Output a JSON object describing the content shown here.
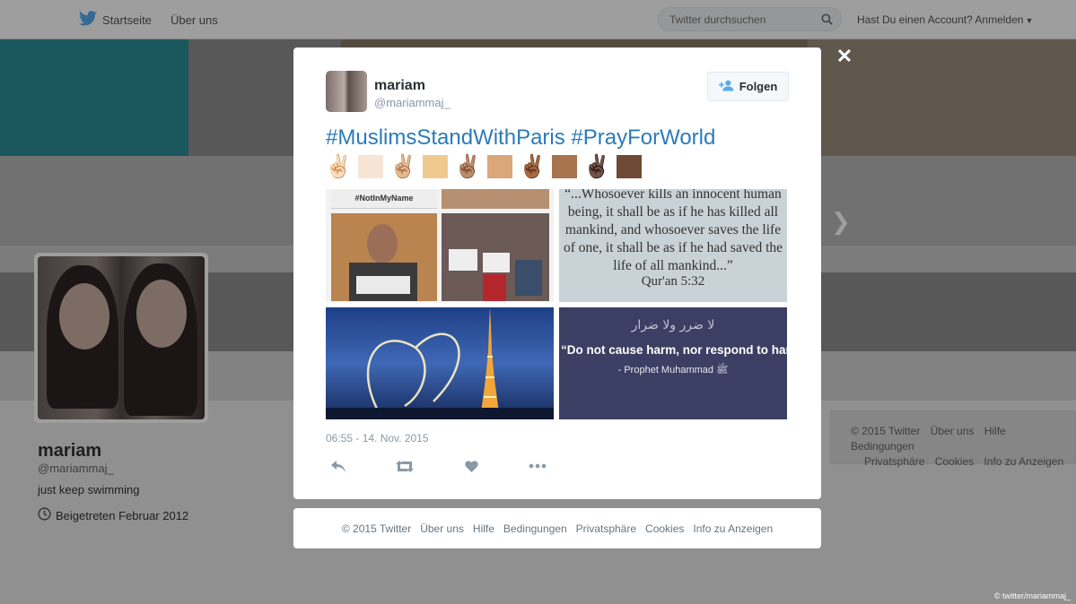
{
  "topbar": {
    "home_label": "Startseite",
    "about_label": "Über uns",
    "search_placeholder": "Twitter durchsuchen",
    "account_label": "Hast Du einen Account? Anmelden"
  },
  "profile": {
    "name": "mariam",
    "handle": "@mariammaj_",
    "bio": "just keep swimming",
    "joined": "Beigetreten Februar 2012"
  },
  "side_footer": {
    "row1": [
      "© 2015 Twitter",
      "Über uns",
      "Hilfe",
      "Bedingungen"
    ],
    "row2": [
      "Privatsphäre",
      "Cookies",
      "Info zu Anzeigen"
    ]
  },
  "tweet": {
    "name": "mariam",
    "handle": "@mariammaj_",
    "follow_label": "Folgen",
    "text": "#MuslimsStandWithParis #PrayForWorld",
    "timestamp": "06:55 - 14. Nov. 2015",
    "emoji": [
      "✌🏻",
      "✌🏼",
      "✌🏽",
      "✌🏾",
      "✌🏿"
    ],
    "skin_swatches": [
      "#f6e5d6",
      "#f0c98f",
      "#d9a77a",
      "#a8744f",
      "#6f4a35"
    ],
    "images": {
      "quote_text": "“...Whosoever kills an innocent human being, it shall be as if he has killed all mankind, and whosoever saves the life of one, it shall be as if he had saved the life of all mankind...”",
      "quote_source": "Qur'an 5:32",
      "arabic_text": "لا ضرر ولا ضرار",
      "hadith_text": "“Do not cause harm, nor respond to harm with harm.”",
      "hadith_source": "- Prophet Muhammad ﷺ",
      "sign_text": "#NotInMyName"
    }
  },
  "modal_footer": [
    "© 2015 Twitter",
    "Über uns",
    "Hilfe",
    "Bedingungen",
    "Privatsphäre",
    "Cookies",
    "Info zu Anzeigen"
  ],
  "credit": "© twitter/mariammaj_",
  "colors": {
    "twitter_blue": "#55acee",
    "hashtag_blue": "#2b7bb9",
    "quote_bg": "#c9d2d6",
    "hadith_bg": "#3b3f63"
  }
}
